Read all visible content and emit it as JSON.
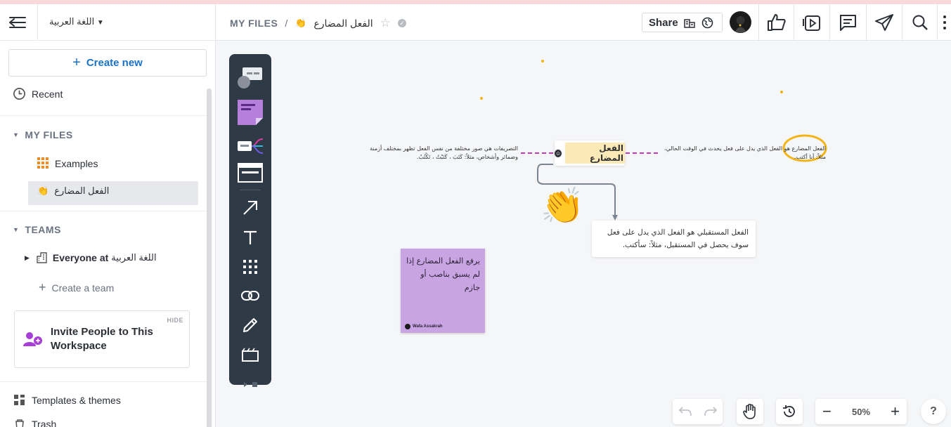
{
  "sidebar": {
    "workspace_name": "اللغة العربية",
    "create_new": "Create new",
    "recent": "Recent",
    "my_files_section": "MY FILES",
    "files": [
      {
        "label": "Examples",
        "icon": "grid-icon"
      },
      {
        "label": "الفعل المضارع",
        "icon": "clapping-hands-emoji"
      }
    ],
    "teams_section": "TEAMS",
    "team_prefix": "Everyone at",
    "team_name": "اللغة العربية",
    "create_team": "Create a team",
    "invite": {
      "hide": "HIDE",
      "text": "Invite People to This Workspace"
    },
    "templates": "Templates & themes",
    "trash": "Trash"
  },
  "header": {
    "breadcrumb_root": "MY FILES",
    "separator": "/",
    "board_title": "الفعل المضارع",
    "share_label": "Share",
    "icons": [
      "like-icon",
      "present-icon",
      "comment-icon",
      "send-icon",
      "search-icon",
      "more-icon"
    ]
  },
  "canvas": {
    "center_node": "الفعل المضارع",
    "left_node": "التصريفات هي صور مختلفة من نفس الفعل تظهر بمختلف أزمنة وضمائر وأشخاص، مثلاً: كَتَبَ ، كَتَبْتُ ، تَكْتُبُ.",
    "right_node": "الفعل المضارع هو الفعل الذي يدل على فعل يحدث في الوقت الحالي، مثلاً: أنا أكتب.",
    "bottom_node": "الفعل المستقبلي هو الفعل الذي يدل على فعل سوف يحصل في المستقبل، مثلاً: سأكتب.",
    "sticky_text": "يرفع الفعل المضارع إذا لم يسبق بناصب أو جازم",
    "sticky_author": "Wafa Assakrah"
  },
  "bottom_bar": {
    "zoom": "50%",
    "minus": "−",
    "plus": "+",
    "help": "?"
  },
  "colors": {
    "accent": "#1a73c9",
    "toolbar": "#2f3a47",
    "sticky": "#c9a4e3",
    "connector": "#c03bb5",
    "highlight": "#f2b518"
  }
}
